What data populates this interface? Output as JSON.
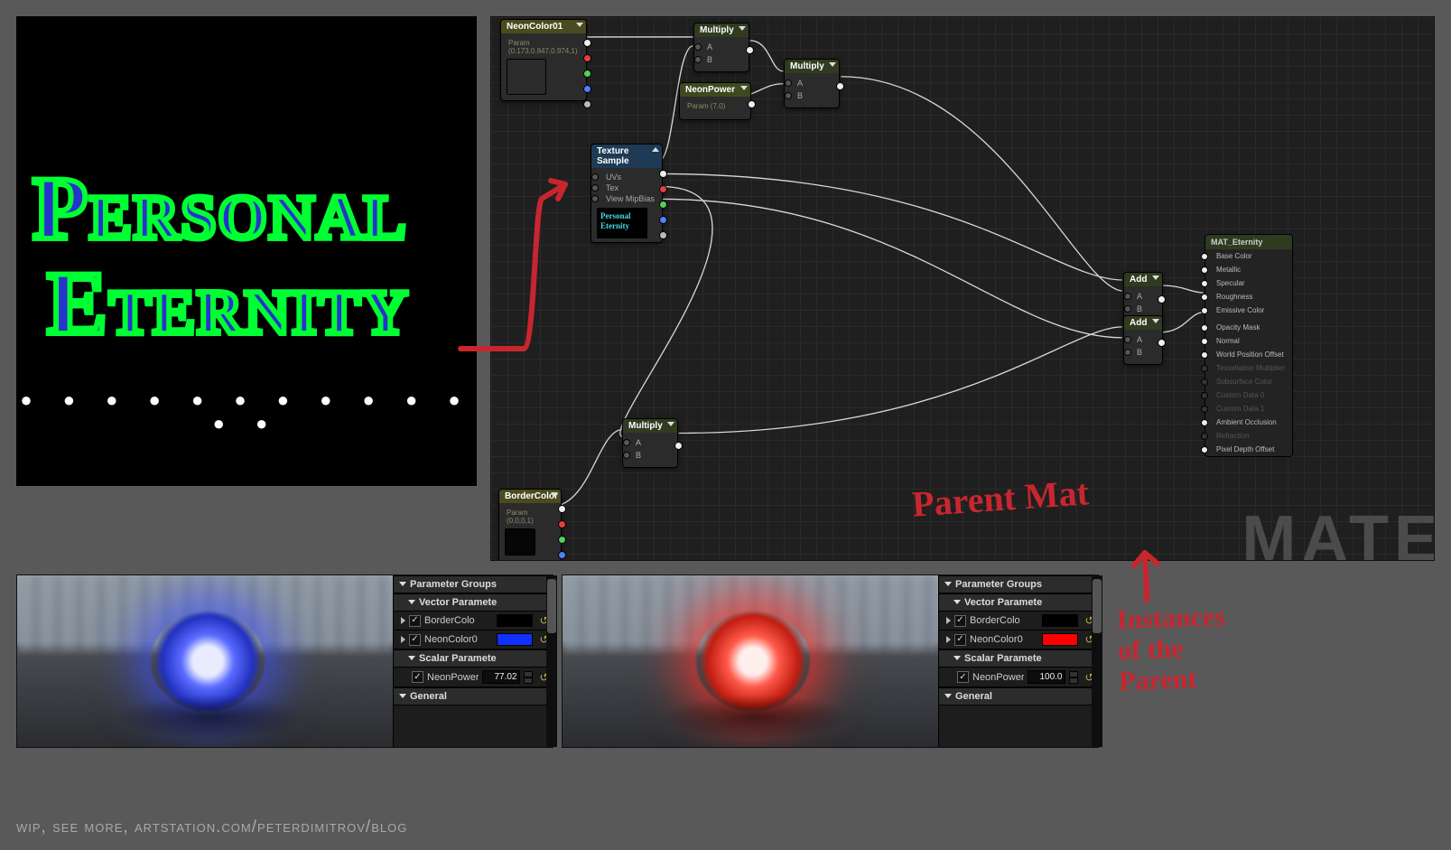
{
  "texture": {
    "line1": "Personal",
    "line2": "Eternity",
    "dots": "● ● ● ● ● ● ● ● ● ● ● ● ●"
  },
  "graph": {
    "watermark": "MATE",
    "nodes": {
      "neon_color": {
        "title": "NeonColor01",
        "sub": "Param (0.173,0.847,0.974,1)",
        "swatch": "#86e5f2"
      },
      "neon_power": {
        "title": "NeonPower",
        "sub": "Param (7.0)"
      },
      "border_color": {
        "title": "BorderColor",
        "sub": "Param (0,0,0,1)",
        "swatch": "#060606"
      },
      "texture_sample": {
        "title": "Texture Sample",
        "inputs": [
          "UVs",
          "Tex",
          "View MipBias"
        ],
        "preview_top": "Personal",
        "preview_bottom": "Eternity"
      },
      "multiply1": {
        "title": "Multiply",
        "a": "A",
        "b": "B"
      },
      "multiply2": {
        "title": "Multiply",
        "a": "A",
        "b": "B"
      },
      "multiply3": {
        "title": "Multiply",
        "a": "A",
        "b": "B"
      },
      "add1": {
        "title": "Add",
        "a": "A",
        "b": "B"
      },
      "add2": {
        "title": "Add",
        "a": "A",
        "b": "B"
      }
    },
    "material_output": {
      "title": "MAT_Eternity",
      "rows": [
        {
          "label": "Base Color",
          "on": true
        },
        {
          "label": "Metallic",
          "on": true
        },
        {
          "label": "Specular",
          "on": true
        },
        {
          "label": "Roughness",
          "on": true
        },
        {
          "label": "Emissive Color",
          "on": true
        },
        {
          "label": "Opacity Mask",
          "on": true,
          "sep": true
        },
        {
          "label": "Normal",
          "on": true
        },
        {
          "label": "World Position Offset",
          "on": true
        },
        {
          "label": "Tessellation Multiplier",
          "on": false
        },
        {
          "label": "Subsurface Color",
          "on": false
        },
        {
          "label": "Custom Data 0",
          "on": false
        },
        {
          "label": "Custom Data 1",
          "on": false
        },
        {
          "label": "Ambient Occlusion",
          "on": true
        },
        {
          "label": "Refraction",
          "on": false
        },
        {
          "label": "Pixel Depth Offset",
          "on": true
        }
      ]
    }
  },
  "instances": {
    "headers": {
      "param_groups": "Parameter Groups",
      "vector": "Vector Paramete",
      "scalar": "Scalar Paramete",
      "general": "General"
    },
    "i1": {
      "border_label": "BorderColo",
      "neon_label": "NeonColor0",
      "power_label": "NeonPower",
      "border_chip": "#000000",
      "neon_chip": "#1030ff",
      "power_value": "77.02"
    },
    "i2": {
      "border_label": "BorderColo",
      "neon_label": "NeonColor0",
      "power_label": "NeonPower",
      "border_chip": "#000000",
      "neon_chip": "#ff0000",
      "power_value": "100.0"
    }
  },
  "annotations": {
    "parent_mat": "Parent Mat",
    "instances_of": "Instances\nof the\nParent"
  },
  "footer": "wip, see more, artstation.com/peterdimitrov/blog"
}
